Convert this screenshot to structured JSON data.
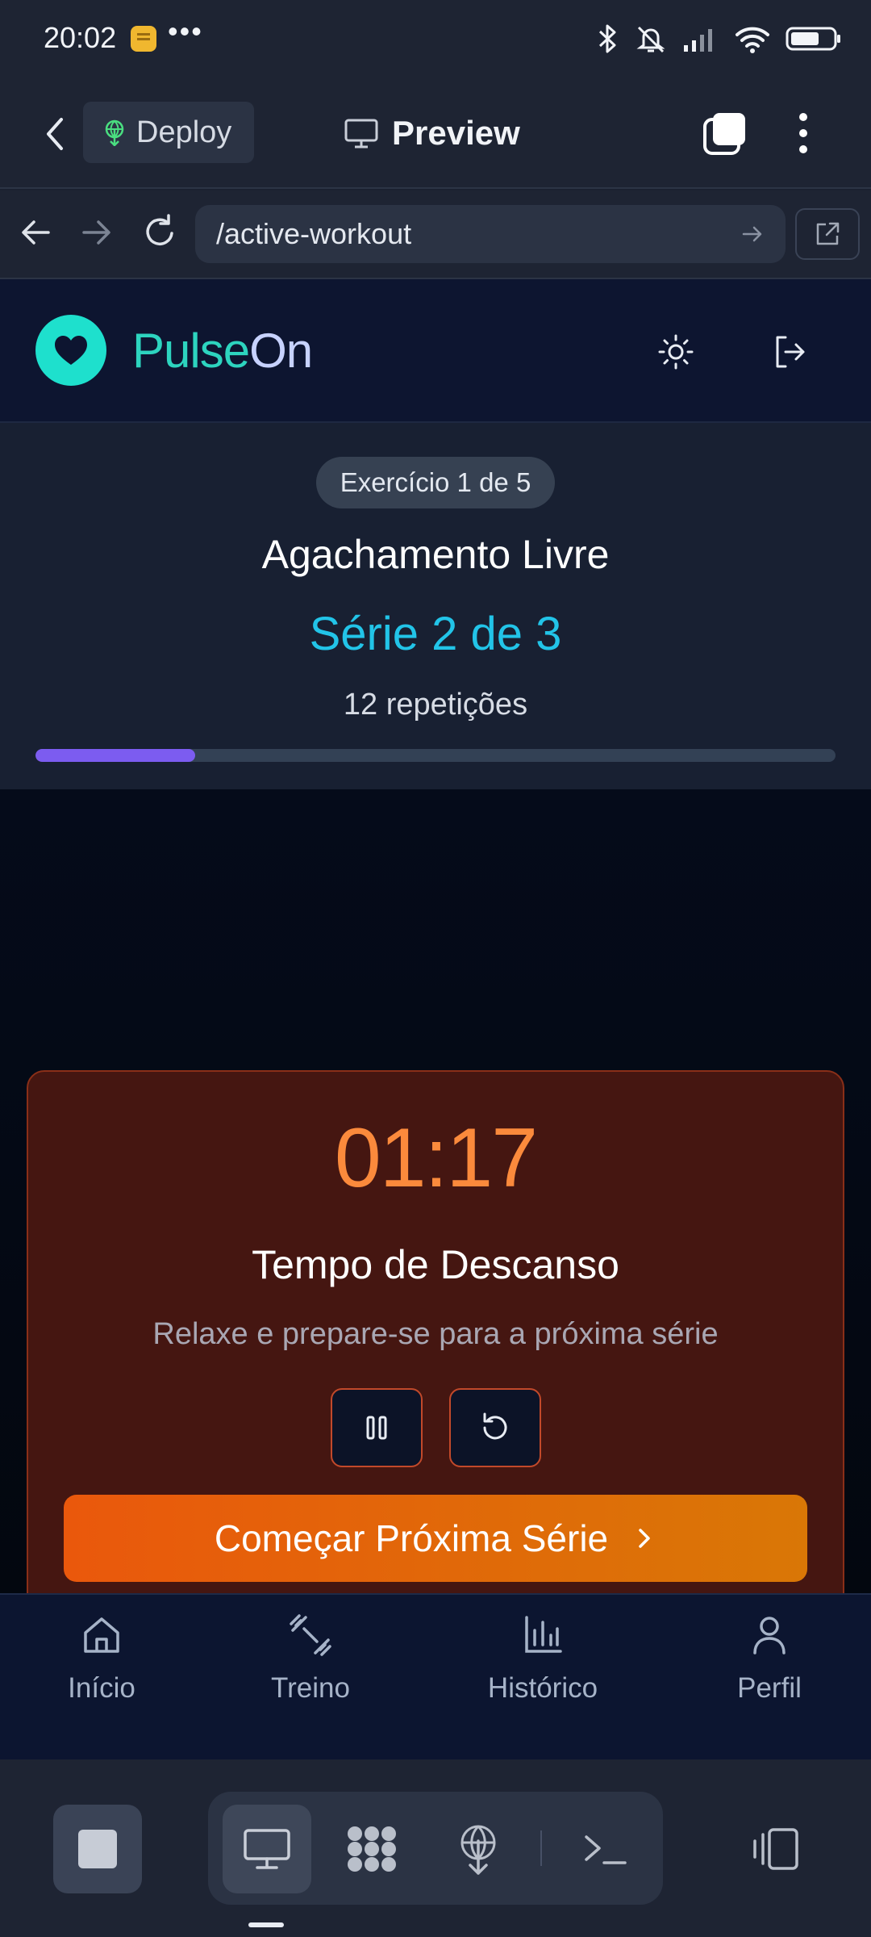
{
  "status_bar": {
    "time": "20:02",
    "more": "•••",
    "icons": [
      "bluetooth-icon",
      "mute-icon",
      "signal-icon",
      "wifi-icon",
      "battery-icon"
    ]
  },
  "app_bar": {
    "deploy_label": "Deploy",
    "preview_label": "Preview"
  },
  "browser": {
    "url": "/active-workout"
  },
  "site": {
    "brand_pulse": "Pulse",
    "brand_on": "On",
    "accent": "#1ee0cd"
  },
  "workout": {
    "exercise_counter": "Exercício 1 de 5",
    "exercise_name": "Agachamento Livre",
    "set_label": "Série 2 de 3",
    "reps_label": "12 repetições",
    "progress_fraction": 0.2
  },
  "rest": {
    "timer": "01:17",
    "title": "Tempo de Descanso",
    "subtitle": "Relaxe e prepare-se para a próxima série",
    "next_label": "Começar Próxima Série"
  },
  "bottom_nav": {
    "items": [
      {
        "label": "Início",
        "icon": "home-icon"
      },
      {
        "label": "Treino",
        "icon": "dumbbell-icon"
      },
      {
        "label": "Histórico",
        "icon": "bar-chart-icon"
      },
      {
        "label": "Perfil",
        "icon": "user-icon"
      }
    ]
  },
  "colors": {
    "timer": "#fb8a3c",
    "set_label": "#22c4e8",
    "progress": "#7c5cf0",
    "cta_start": "#ea580c",
    "cta_end": "#d97706"
  }
}
